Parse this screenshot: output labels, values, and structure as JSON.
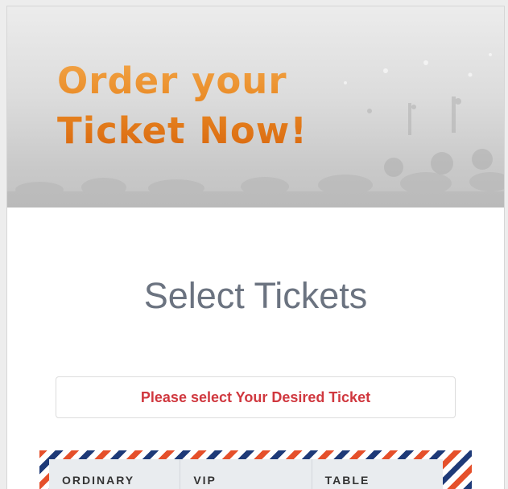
{
  "hero": {
    "line1": "Order your",
    "line2": "Ticket Now!"
  },
  "main": {
    "title": "Select Tickets",
    "notice": "Please select Your Desired Ticket"
  },
  "tickets": {
    "columns": [
      "ORDINARY",
      "VIP",
      "TABLE"
    ]
  },
  "colors": {
    "accent_orange": "#e98a25",
    "notice_red": "#d0383f",
    "stripe_red": "#e5502b",
    "stripe_blue": "#1e3a78"
  }
}
